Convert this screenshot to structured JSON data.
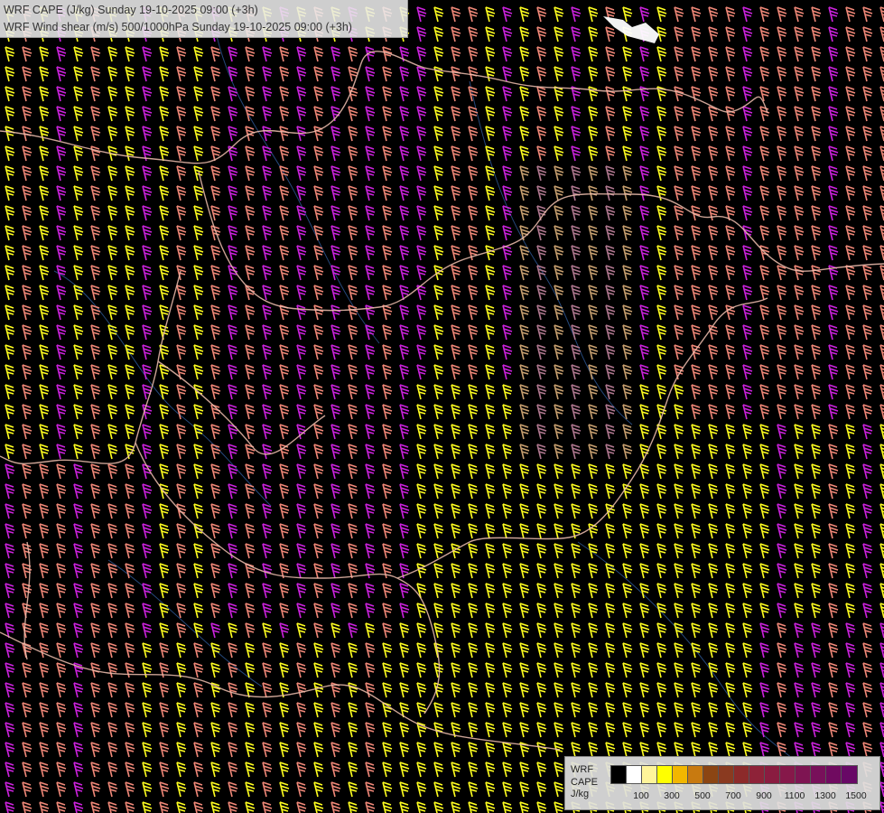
{
  "header": {
    "line1": "WRF CAPE (J/kg) Sunday 19-10-2025 09:00 (+3h)",
    "line2": "WRF Wind shear (m/s) 500/1000hPa Sunday 19-10-2025 09:00 (+3h)"
  },
  "legend": {
    "label_model": "WRF",
    "label_field": "CAPE",
    "label_unit": "J/kg",
    "colors": [
      "#000000",
      "#ffffff",
      "#fff59a",
      "#ffff00",
      "#f2b700",
      "#c87a10",
      "#8b4513",
      "#8a3a20",
      "#8c2a2a",
      "#8e2238",
      "#8a1c40",
      "#86184a",
      "#7e1452",
      "#78105a",
      "#700a60",
      "#680866"
    ],
    "ticks": [
      "100",
      "300",
      "500",
      "700",
      "900",
      "1100",
      "1300",
      "1500"
    ]
  },
  "barb_colors": {
    "yellow": "#ffff20",
    "salmon": "#f08878",
    "magenta": "#cc22dd",
    "tan": "#c8a070",
    "mauve": "#b07890"
  }
}
